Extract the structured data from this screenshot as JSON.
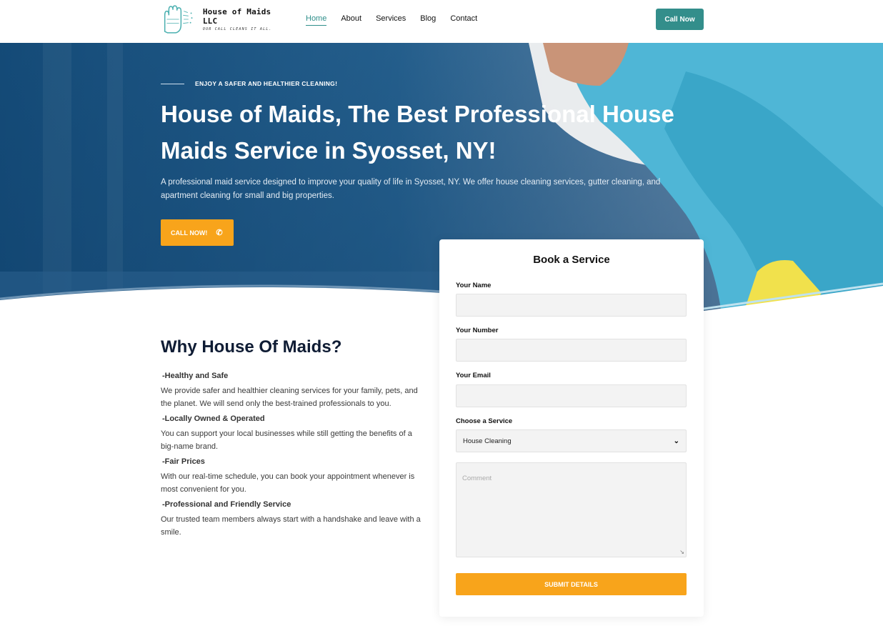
{
  "header": {
    "logo_title": "House of Maids LLC",
    "logo_tagline": "OUR CALL CLEANS IT ALL.",
    "nav": [
      "Home",
      "About",
      "Services",
      "Blog",
      "Contact"
    ],
    "cta": "Call Now"
  },
  "hero": {
    "eyebrow": "ENJOY A SAFER AND HEALTHIER CLEANING!",
    "title_line1": "House of Maids, The Best Professional House",
    "title_line2": "Maids Service in Syosset, NY!",
    "description": "A professional maid service designed to improve your quality of life in Syosset, NY. We offer house cleaning services, gutter cleaning, and apartment cleaning for small and big properties.",
    "cta": "CALL NOW!",
    "cta_icon": "phone-icon"
  },
  "why": {
    "title": "Why House Of Maids?",
    "items": [
      {
        "heading": "-Healthy and Safe",
        "body": "We provide safer and healthier cleaning services for your family, pets, and the planet. We will send only the best-trained professionals to you."
      },
      {
        "heading": "-Locally Owned & Operated",
        "body": "You can support your local businesses while still getting the benefits of a big-name brand."
      },
      {
        "heading": "-Fair Prices",
        "body": "With our real-time schedule, you can book your appointment whenever is most convenient for you."
      },
      {
        "heading": "-Professional and Friendly Service",
        "body": "Our trusted team members always start with a handshake and leave with a smile."
      }
    ]
  },
  "form": {
    "title": "Book a Service",
    "name_label": "Your Name",
    "number_label": "Your Number",
    "email_label": "Your Email",
    "service_label": "Choose a Service",
    "service_selected": "House Cleaning",
    "comment_placeholder": "Comment",
    "submit": "SUBMIT DETAILS"
  },
  "colors": {
    "teal": "#338e8b",
    "orange": "#f8a41b",
    "navy": "#0f1c34",
    "hero_blue": "#1d5a8c",
    "hero_aqua": "#3bb3d6"
  }
}
